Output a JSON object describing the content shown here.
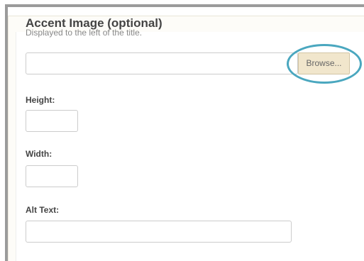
{
  "section": {
    "title": "Accent Image (optional)",
    "description": "Displayed to the left of the title."
  },
  "file": {
    "value": "",
    "browse_label": "Browse..."
  },
  "fields": {
    "height_label": "Height:",
    "height_value": "",
    "width_label": "Width:",
    "width_value": "",
    "alt_label": "Alt Text:",
    "alt_value": ""
  },
  "colors": {
    "highlight_ring": "#4aa7bf",
    "browse_bg": "#f1e6cc"
  }
}
